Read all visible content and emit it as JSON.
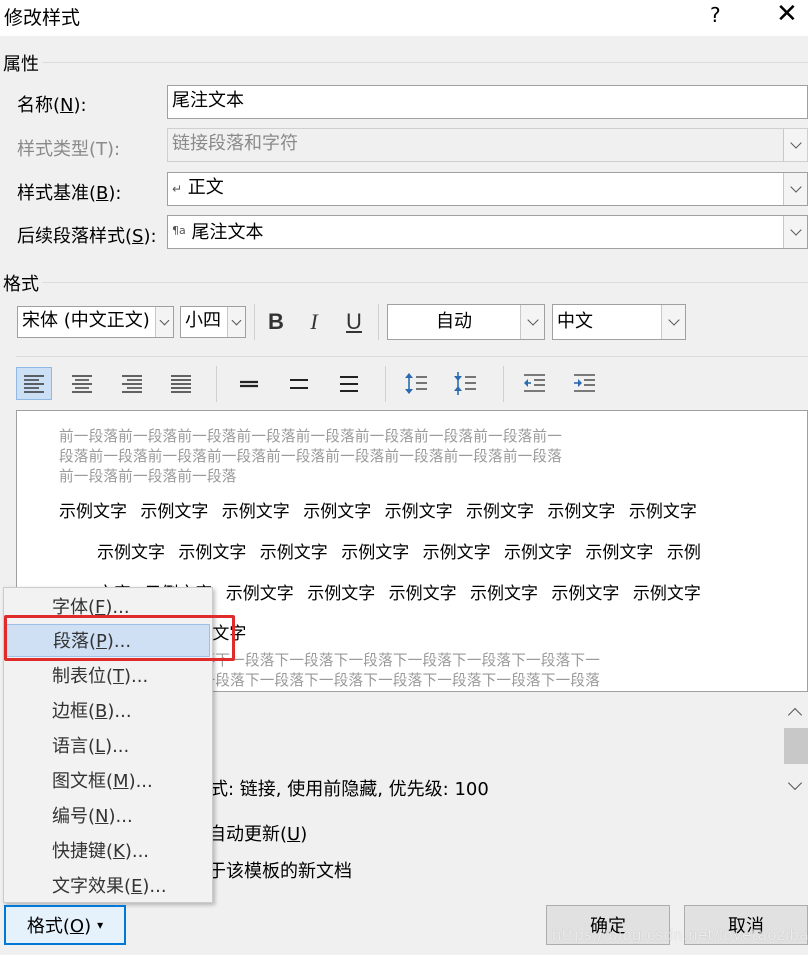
{
  "window": {
    "title": "修改样式",
    "help_label": "?",
    "close_label": "✕"
  },
  "properties": {
    "section_label": "属性",
    "name_label": "名称(N):",
    "name_value": "尾注文本",
    "style_type_label": "样式类型(T):",
    "style_type_value": "链接段落和字符",
    "based_on_label": "样式基准(B):",
    "based_on_glyph": "↵",
    "based_on_value": "正文",
    "next_style_label": "后续段落样式(S):",
    "next_style_glyph": "¶a",
    "next_style_value": "尾注文本"
  },
  "format": {
    "section_label": "格式",
    "font_value": "宋体 (中文正文)",
    "size_value": "小四",
    "bold_label": "B",
    "italic_label": "I",
    "underline_label": "U",
    "color_value": "自动",
    "language_value": "中文"
  },
  "toolbar_icons": [
    "align-left-icon",
    "align-center-icon",
    "align-right-icon",
    "justify-icon",
    "single-spacing-icon",
    "one-half-spacing-icon",
    "double-spacing-icon",
    "increase-paragraph-spacing-icon",
    "decrease-paragraph-spacing-icon",
    "decrease-indent-icon",
    "increase-indent-icon"
  ],
  "preview": {
    "prev_line1": "前一段落前一段落前一段落前一段落前一段落前一段落前一段落前一段落前一",
    "prev_line2": "段落前一段落前一段落前一段落前一段落前一段落前一段落前一段落前一段落",
    "prev_line3": "前一段落前一段落前一段落",
    "sample_line1": "示例文字 示例文字 示例文字 示例文字 示例文字 示例文字 示例文字 示例文字",
    "sample_line2": "示例文字 示例文字 示例文字 示例文字 示例文字 示例文字 示例文字 示例",
    "sample_line3": "文字 示例文字 示例文字 示例文字 示例文字 示例文字 示例文字 示例文字",
    "sample_line4": "示例文字 示例文字",
    "sample_line4_visible": "例文字 示例文字",
    "next_line1": "下一段落下一段落下一段落下一段落下一段落下一段落下一段落下一段落下一",
    "next_line2": "段落下一段落下一段落下一段落下一段落下一段落下一段落下一段落下一段落",
    "next_line1_visible": "段落下一段落下一段落下一段落下一段落下一段落下一段落下一段落下一",
    "next_line2_visible": "下一段落下一段落下一段落下一段落下一段落下一段落下一段落下一段落"
  },
  "description": {
    "text_visible": "式: 链接, 使用前隐藏, 优先级: 100"
  },
  "options": {
    "auto_update_visible": "自动更新(U)",
    "new_docs_visible": "于该模板的新文档"
  },
  "format_menu": {
    "items": [
      {
        "label": "字体(F)...",
        "key": "F"
      },
      {
        "label": "段落(P)...",
        "key": "P"
      },
      {
        "label": "制表位(T)...",
        "key": "T"
      },
      {
        "label": "边框(B)...",
        "key": "B"
      },
      {
        "label": "语言(L)...",
        "key": "L"
      },
      {
        "label": "图文框(M)...",
        "key": "M"
      },
      {
        "label": "编号(N)...",
        "key": "N"
      },
      {
        "label": "快捷键(K)...",
        "key": "K"
      },
      {
        "label": "文字效果(E)...",
        "key": "E"
      }
    ],
    "highlighted_index": 1
  },
  "buttons": {
    "format_label": "格式(O)",
    "format_arrow": "▾",
    "ok_label": "确定",
    "cancel_label": "取消"
  },
  "watermark": "https://blog.csdn.net/lovetaozibaby",
  "colors": {
    "highlight_box": "#e02b2b",
    "menu_highlight": "#cfe0f5",
    "accent": "#0078d7"
  }
}
